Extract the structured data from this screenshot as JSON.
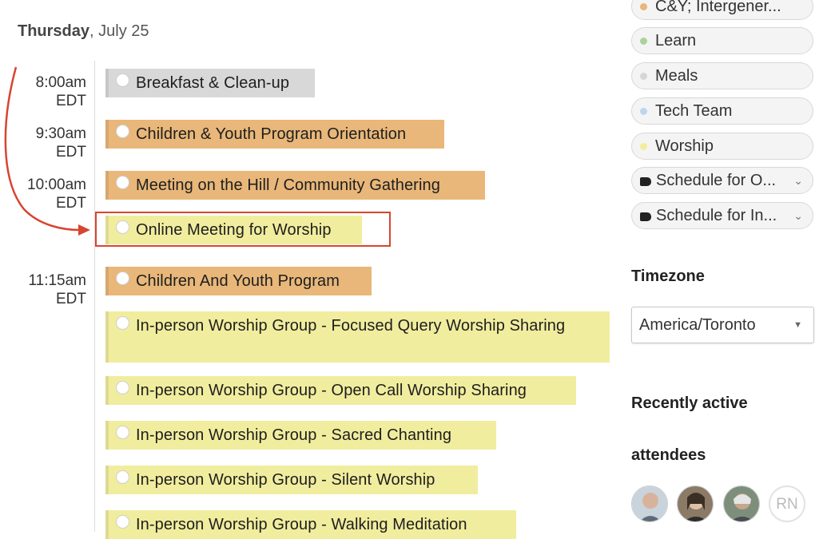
{
  "date_header": {
    "weekday": "Thursday",
    "date": ", July 25"
  },
  "times": [
    {
      "time": "8:00am",
      "tz": "EDT"
    },
    {
      "time": "9:30am",
      "tz": "EDT"
    },
    {
      "time": "10:00am",
      "tz": "EDT"
    },
    {
      "time": "11:15am",
      "tz": "EDT"
    }
  ],
  "events": [
    {
      "title": "Breakfast & Clean-up",
      "category": "Meals",
      "color": "#d8d8d8"
    },
    {
      "title": "Children & Youth Program Orientation",
      "category": "C&Y",
      "color": "#e8b779"
    },
    {
      "title": "Meeting on the Hill / Community Gathering",
      "category": "C&Y",
      "color": "#e8b779"
    },
    {
      "title": "Online Meeting for Worship",
      "category": "Worship",
      "color": "#f1ed9e",
      "highlighted": true
    },
    {
      "title": "Children And Youth Program",
      "category": "C&Y",
      "color": "#e8b779"
    },
    {
      "title": "In-person Worship Group - Focused Query Worship Sharing",
      "category": "Worship",
      "color": "#f1ed9e"
    },
    {
      "title": "In-person Worship Group - Open Call Worship Sharing",
      "category": "Worship",
      "color": "#f1ed9e"
    },
    {
      "title": "In-person Worship Group - Sacred Chanting",
      "category": "Worship",
      "color": "#f1ed9e"
    },
    {
      "title": "In-person Worship Group - Silent Worship",
      "category": "Worship",
      "color": "#f1ed9e"
    },
    {
      "title": "In-person Worship Group - Walking Meditation",
      "category": "Worship",
      "color": "#f1ed9e"
    }
  ],
  "filters": [
    {
      "label": "C&Y; Intergener...",
      "dot_color": "#e8b779"
    },
    {
      "label": "Learn",
      "dot_color": "#a9d39e"
    },
    {
      "label": "Meals",
      "dot_color": "#d6d6d6"
    },
    {
      "label": "Tech Team",
      "dot_color": "#bcd6f2"
    },
    {
      "label": "Worship",
      "dot_color": "#f1ed9e"
    },
    {
      "label": "Schedule for O...",
      "type": "tag"
    },
    {
      "label": "Schedule for In...",
      "type": "tag"
    }
  ],
  "timezone": {
    "label": "Timezone",
    "value": "America/Toronto"
  },
  "attendees": {
    "label_line1": "Recently active",
    "label_line2": "attendees",
    "avatars": [
      {
        "kind": "photo"
      },
      {
        "kind": "photo"
      },
      {
        "kind": "photo"
      },
      {
        "kind": "initials",
        "initials": "RN"
      }
    ]
  },
  "colors": {
    "highlight": "#d84530",
    "orange": "#e8b779",
    "yellow": "#f1ed9e",
    "gray": "#d8d8d8"
  }
}
